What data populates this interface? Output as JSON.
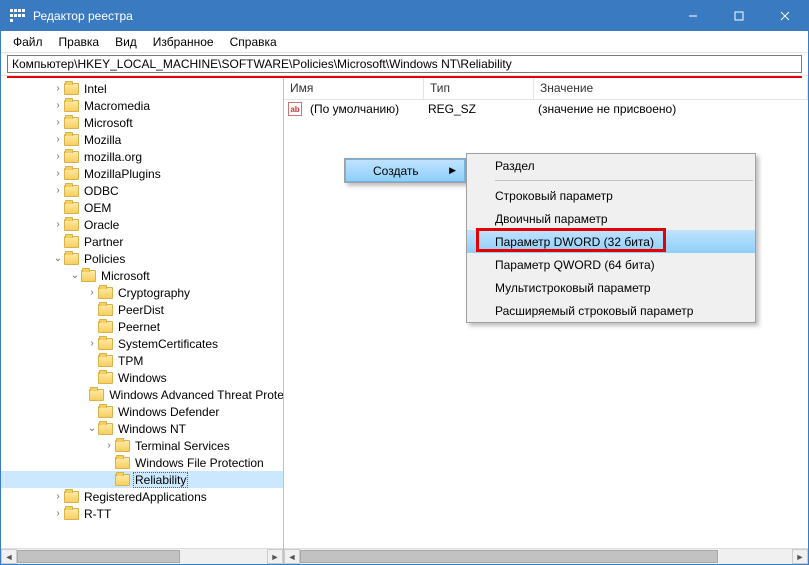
{
  "window": {
    "title": "Редактор реестра"
  },
  "menu": [
    "Файл",
    "Правка",
    "Вид",
    "Избранное",
    "Справка"
  ],
  "address": "Компьютер\\HKEY_LOCAL_MACHINE\\SOFTWARE\\Policies\\Microsoft\\Windows NT\\Reliability",
  "tree": [
    {
      "indent": 3,
      "exp": "closed",
      "label": "Intel"
    },
    {
      "indent": 3,
      "exp": "closed",
      "label": "Macromedia"
    },
    {
      "indent": 3,
      "exp": "closed",
      "label": "Microsoft"
    },
    {
      "indent": 3,
      "exp": "closed",
      "label": "Mozilla"
    },
    {
      "indent": 3,
      "exp": "closed",
      "label": "mozilla.org"
    },
    {
      "indent": 3,
      "exp": "closed",
      "label": "MozillaPlugins"
    },
    {
      "indent": 3,
      "exp": "closed",
      "label": "ODBC"
    },
    {
      "indent": 3,
      "exp": "none",
      "label": "OEM"
    },
    {
      "indent": 3,
      "exp": "closed",
      "label": "Oracle"
    },
    {
      "indent": 3,
      "exp": "none",
      "label": "Partner"
    },
    {
      "indent": 3,
      "exp": "open",
      "label": "Policies"
    },
    {
      "indent": 4,
      "exp": "open",
      "label": "Microsoft"
    },
    {
      "indent": 5,
      "exp": "closed",
      "label": "Cryptography"
    },
    {
      "indent": 5,
      "exp": "none",
      "label": "PeerDist"
    },
    {
      "indent": 5,
      "exp": "none",
      "label": "Peernet"
    },
    {
      "indent": 5,
      "exp": "closed",
      "label": "SystemCertificates"
    },
    {
      "indent": 5,
      "exp": "none",
      "label": "TPM"
    },
    {
      "indent": 5,
      "exp": "none",
      "label": "Windows"
    },
    {
      "indent": 5,
      "exp": "none",
      "label": "Windows Advanced Threat Protection"
    },
    {
      "indent": 5,
      "exp": "none",
      "label": "Windows Defender"
    },
    {
      "indent": 5,
      "exp": "open",
      "label": "Windows NT"
    },
    {
      "indent": 6,
      "exp": "closed",
      "label": "Terminal Services"
    },
    {
      "indent": 6,
      "exp": "none",
      "label": "Windows File Protection"
    },
    {
      "indent": 6,
      "exp": "none",
      "label": "Reliability",
      "selected": true
    },
    {
      "indent": 3,
      "exp": "closed",
      "label": "RegisteredApplications"
    },
    {
      "indent": 3,
      "exp": "closed",
      "label": "R-TT"
    }
  ],
  "list": {
    "columns": {
      "name": "Имя",
      "type": "Тип",
      "value": "Значение"
    },
    "rows": [
      {
        "name": "(По умолчанию)",
        "type": "REG_SZ",
        "value": "(значение не присвоено)"
      }
    ]
  },
  "context": {
    "create": "Создать",
    "sub": [
      {
        "label": "Раздел",
        "sep_after": true
      },
      {
        "label": "Строковый параметр"
      },
      {
        "label": "Двоичный параметр"
      },
      {
        "label": "Параметр DWORD (32 бита)",
        "highlighted": true
      },
      {
        "label": "Параметр QWORD (64 бита)"
      },
      {
        "label": "Мультистроковый параметр"
      },
      {
        "label": "Расширяемый строковый параметр"
      }
    ]
  }
}
